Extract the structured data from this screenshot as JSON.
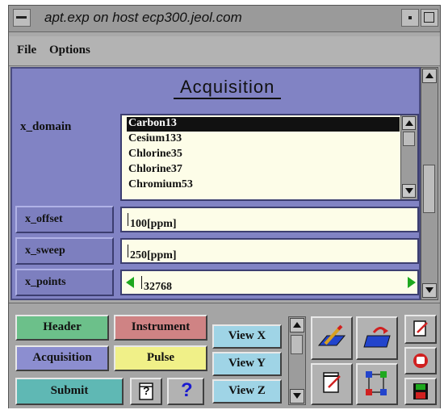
{
  "window": {
    "title": "apt.exp on host ecp300.jeol.com"
  },
  "menubar": {
    "file": "File",
    "options": "Options"
  },
  "panel": {
    "heading": "Acquisition",
    "x_domain": {
      "label": "x_domain",
      "items": [
        "Carbon13",
        "Cesium133",
        "Chlorine35",
        "Chlorine37",
        "Chromium53"
      ],
      "selected": "Carbon13"
    },
    "x_offset": {
      "label": "x_offset",
      "value": "100[ppm]"
    },
    "x_sweep": {
      "label": "x_sweep",
      "value": "250[ppm]"
    },
    "x_points": {
      "label": "x_points",
      "value": "32768"
    }
  },
  "buttons": {
    "header": "Header",
    "instrument": "Instrument",
    "acquisition": "Acquisition",
    "pulse": "Pulse",
    "submit": "Submit",
    "view_x": "View X",
    "view_y": "View Y",
    "view_z": "View Z",
    "help_context": "?",
    "help": "?"
  },
  "colors": {
    "panel": "#8183c4",
    "header_btn": "#6cc08a",
    "instrument_btn": "#cf8384",
    "acquisition_btn": "#8c8ed0",
    "pulse_btn": "#f0f088",
    "submit_btn": "#5fb8b4",
    "view_btn": "#9fd4e6",
    "arrow_green": "#1ea81e"
  },
  "icons": [
    "edit-pencil-icon",
    "open-folder-icon",
    "notepad-icon",
    "flowchart-icon",
    "export-icon",
    "hand-stop-icon",
    "save-disk-icon"
  ]
}
